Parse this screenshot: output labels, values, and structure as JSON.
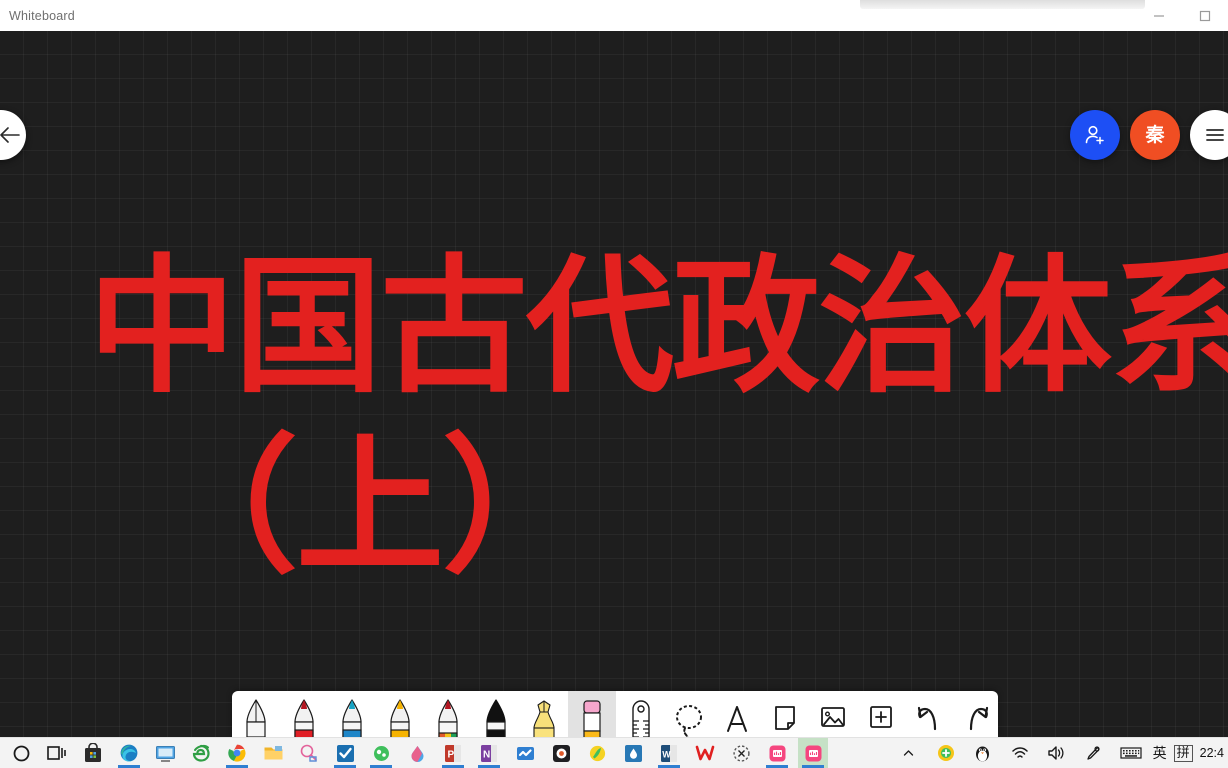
{
  "window": {
    "title": "Whiteboard",
    "minimize_label": "Minimize",
    "maximize_label": "Maximize"
  },
  "canvas": {
    "background_color": "#1e1e1e",
    "grid_color": "#2b2b2b",
    "grid_size_px": 24
  },
  "slide": {
    "text_color": "#e3211f",
    "line1": "中国古代政治体系",
    "line2": "（上）"
  },
  "floating": {
    "back_label": "Back",
    "invite_label": "Invite",
    "avatar_initial": "秦",
    "menu_label": "Menu",
    "invite_color": "#1d4ff5",
    "avatar_color": "#f04e23"
  },
  "toolbar": {
    "selected_tool": "eraser",
    "tools": [
      {
        "name": "pen-gray",
        "label": "Pen Gray",
        "color": "#c9c9c9"
      },
      {
        "name": "pen-red",
        "label": "Pen Red",
        "color": "#e01f26"
      },
      {
        "name": "pen-blue",
        "label": "Pen Blue",
        "color": "#1f86c8"
      },
      {
        "name": "pen-yellow",
        "label": "Pen Yellow",
        "color": "#f5b301"
      },
      {
        "name": "pen-multicolor",
        "label": "Pen Multicolor",
        "color": "#e05a2b"
      },
      {
        "name": "pen-black",
        "label": "Pen Black",
        "color": "#111111"
      },
      {
        "name": "highlighter",
        "label": "Highlighter",
        "color": "#f7e07a"
      },
      {
        "name": "eraser",
        "label": "Eraser",
        "color": "#f6a6cc"
      },
      {
        "name": "ruler",
        "label": "Ruler",
        "color": "#1a1a1a"
      },
      {
        "name": "lasso-select",
        "label": "Lasso Select",
        "color": "#1a1a1a"
      },
      {
        "name": "text",
        "label": "Text",
        "color": "#1a1a1a"
      },
      {
        "name": "sticky-note",
        "label": "Sticky Note",
        "color": "#1a1a1a"
      },
      {
        "name": "insert-image",
        "label": "Insert Image",
        "color": "#1a1a1a"
      },
      {
        "name": "add",
        "label": "Add",
        "color": "#1a1a1a"
      },
      {
        "name": "undo",
        "label": "Undo",
        "color": "#1a1a1a"
      },
      {
        "name": "redo",
        "label": "Redo",
        "color": "#1a1a1a"
      }
    ]
  },
  "taskbar": {
    "apps": [
      {
        "name": "cortana",
        "label": "Cortana"
      },
      {
        "name": "task-view",
        "label": "Task View"
      },
      {
        "name": "microsoft-store",
        "label": "Microsoft Store"
      },
      {
        "name": "microsoft-edge",
        "label": "Microsoft Edge"
      },
      {
        "name": "remote-desktop",
        "label": "Remote Desktop"
      },
      {
        "name": "internet-explorer",
        "label": "Internet Explorer"
      },
      {
        "name": "google-chrome",
        "label": "Google Chrome"
      },
      {
        "name": "file-explorer",
        "label": "File Explorer"
      },
      {
        "name": "snipaste",
        "label": "Snipaste"
      },
      {
        "name": "check-app",
        "label": "To Do"
      },
      {
        "name": "green-app",
        "label": "App"
      },
      {
        "name": "paint-app",
        "label": "Paint"
      },
      {
        "name": "powerpoint",
        "label": "PowerPoint"
      },
      {
        "name": "onenote",
        "label": "OneNote"
      },
      {
        "name": "blue-wave-app",
        "label": "App"
      },
      {
        "name": "dark-circle-app",
        "label": "App"
      },
      {
        "name": "yellow-app",
        "label": "App"
      },
      {
        "name": "blue-drop-app",
        "label": "App"
      },
      {
        "name": "word",
        "label": "Word"
      },
      {
        "name": "wps",
        "label": "WPS"
      },
      {
        "name": "dotted-circle-app",
        "label": "App"
      },
      {
        "name": "pink-app-1",
        "label": "App"
      },
      {
        "name": "pink-app-2",
        "label": "Whiteboard"
      }
    ],
    "tray": {
      "overflow_label": "Show hidden icons",
      "security_label": "Security",
      "qq_label": "QQ",
      "network_label": "Network",
      "volume_label": "Volume",
      "pen_label": "Pen",
      "keyboard_label": "Touch Keyboard",
      "ime_lang": "英",
      "ime_mode": "拼",
      "clock": "22:4"
    }
  }
}
